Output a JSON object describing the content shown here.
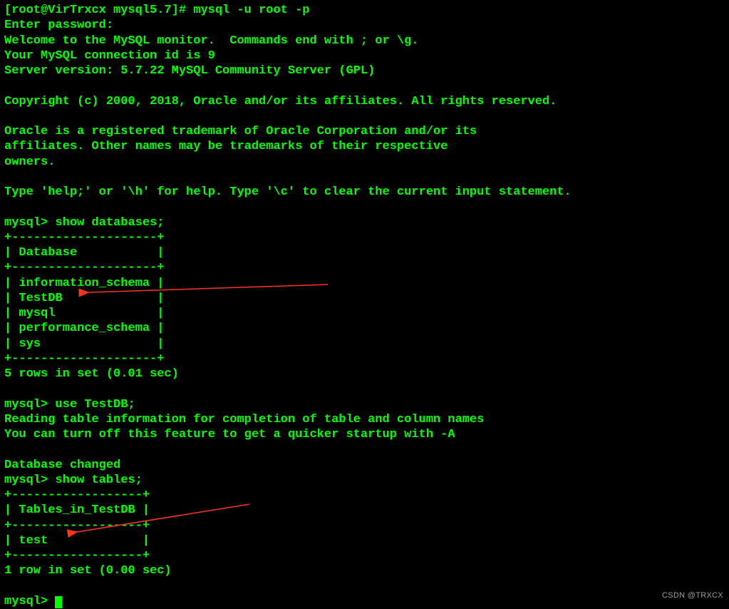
{
  "shell": {
    "prompt": "[root@VirTrxcx mysql5.7]# ",
    "command": "mysql -u root -p"
  },
  "lines": {
    "enter_password": "Enter password:",
    "welcome1": "Welcome to the MySQL monitor.  Commands end with ; or \\g.",
    "welcome2": "Your MySQL connection id is 9",
    "welcome3": "Server version: 5.7.22 MySQL Community Server (GPL)",
    "copyright": "Copyright (c) 2000, 2018, Oracle and/or its affiliates. All rights reserved.",
    "trademark1": "Oracle is a registered trademark of Oracle Corporation and/or its",
    "trademark2": "affiliates. Other names may be trademarks of their respective",
    "trademark3": "owners.",
    "help": "Type 'help;' or '\\h' for help. Type '\\c' to clear the current input statement."
  },
  "mysql_prompt": "mysql> ",
  "commands": {
    "show_databases": "show databases;",
    "use_testdb": "use TestDB;",
    "show_tables": "show tables;"
  },
  "databases": {
    "border_top": "+--------------------+",
    "header_row": "| Database           |",
    "border_mid": "+--------------------+",
    "rows": [
      "| information_schema |",
      "| TestDB             |",
      "| mysql              |",
      "| performance_schema |",
      "| sys                |"
    ],
    "border_bot": "+--------------------+",
    "result": "5 rows in set (0.01 sec)"
  },
  "use_db": {
    "reading": "Reading table information for completion of table and column names",
    "turnoff": "You can turn off this feature to get a quicker startup with -A",
    "changed": "Database changed"
  },
  "tables": {
    "border_top": "+------------------+",
    "header_row": "| Tables_in_TestDB |",
    "border_mid": "+------------------+",
    "rows": [
      "| test             |"
    ],
    "border_bot": "+------------------+",
    "result": "1 row in set (0.00 sec)"
  },
  "watermark": "CSDN @TRXCX"
}
